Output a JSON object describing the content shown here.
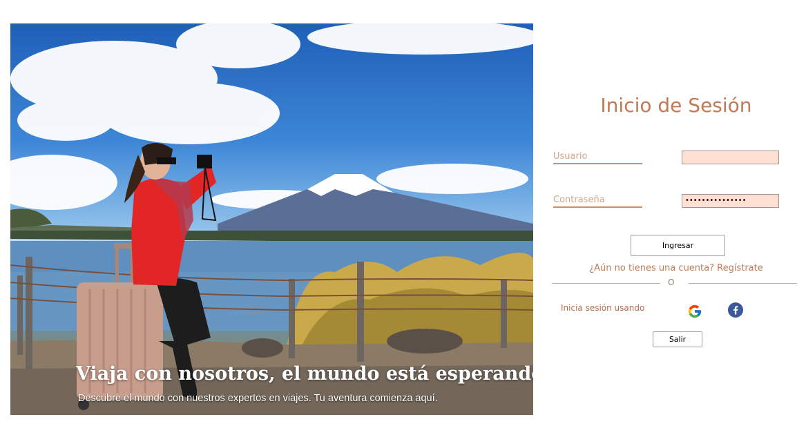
{
  "hero": {
    "title": "Viaja con nosotros, el mundo está esperando",
    "subtitle": "Descubre el mundo con nuestros expertos en viajes. Tu aventura comienza aquí."
  },
  "login": {
    "title": "Inicio de Sesión",
    "username_label": "Usuario",
    "username_value": "",
    "password_label": "Contraseña",
    "password_value": "•••••••••••••••",
    "submit_label": "Ingresar",
    "register_text": "¿Aún no tienes una cuenta? Regístrate",
    "divider_text": "O",
    "social_label": "Inicia sesión usando",
    "social_icons": [
      "google-icon",
      "facebook-icon"
    ],
    "exit_label": "Salir"
  },
  "colors": {
    "accent": "#c07a55",
    "input_bg": "#ffe0d2",
    "facebook": "#3b5998"
  }
}
